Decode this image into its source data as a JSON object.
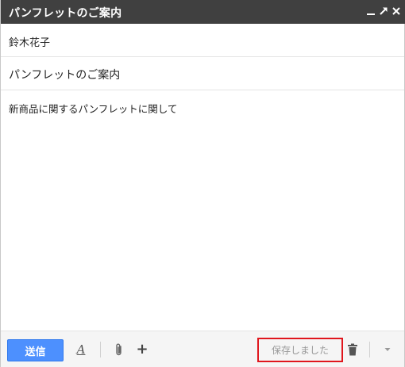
{
  "window": {
    "title": "パンフレットのご案内",
    "controls": [
      "minimize-icon",
      "popout-icon",
      "close-icon"
    ]
  },
  "recipients": {
    "to": "鈴木花子"
  },
  "subject": {
    "value": "パンフレットのご案内"
  },
  "body": {
    "text": "新商品に関するパンフレットに関して"
  },
  "toolbar": {
    "send_label": "送信",
    "formatting_icon": "A",
    "attach_icon": "paperclip-icon",
    "more_options_symbol": "+",
    "saved_status": "保存しました",
    "delete_icon": "trash-icon",
    "dropdown_icon": "chevron-down-icon"
  },
  "colors": {
    "titlebar": "#404040",
    "send_button": "#4d90fe",
    "highlight_border": "#e0161d"
  }
}
